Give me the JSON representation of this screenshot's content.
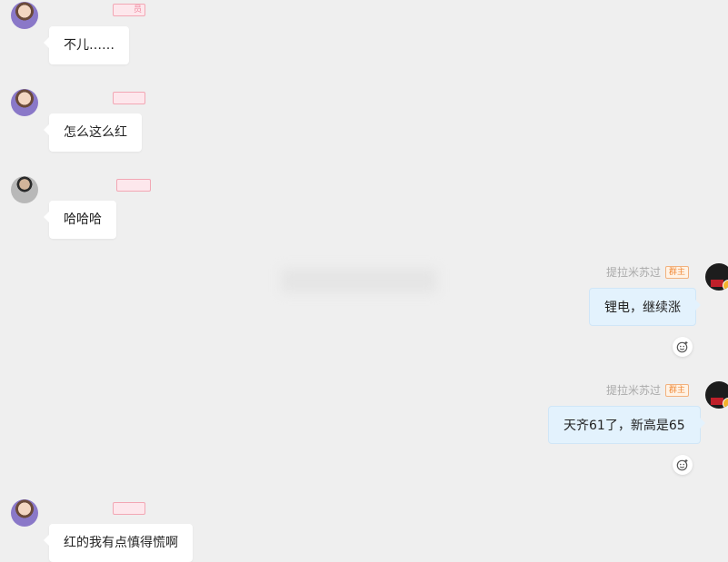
{
  "messages": [
    {
      "side": "left",
      "sender_name": "",
      "tag": "员",
      "text": "不儿……"
    },
    {
      "side": "left",
      "sender_name": "",
      "tag": "",
      "text": "怎么这么红"
    },
    {
      "side": "left",
      "sender_name": "",
      "tag": "",
      "text": "哈哈哈"
    },
    {
      "side": "right",
      "sender_name": "提拉米苏过",
      "tag": "群主",
      "text": "锂电，继续涨"
    },
    {
      "side": "right",
      "sender_name": "提拉米苏过",
      "tag": "群主",
      "text": "天齐61了，新高是65"
    },
    {
      "side": "left",
      "sender_name": "",
      "tag": "",
      "text": "红的我有点慎得慌啊"
    }
  ],
  "icons": {
    "reaction": "add-reaction-icon"
  },
  "colors": {
    "background": "#efefef",
    "incoming_bubble": "#ffffff",
    "outgoing_bubble": "#e3f2fd",
    "owner_tag": "#f08b3a"
  }
}
